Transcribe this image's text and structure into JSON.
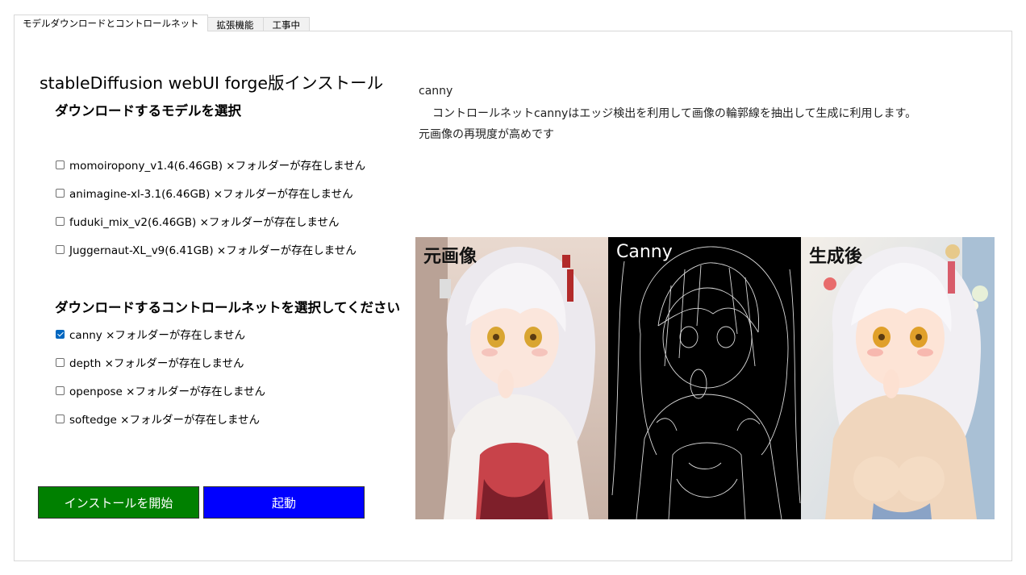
{
  "tabs": [
    {
      "label": "モデルダウンロードとコントロールネット",
      "active": true
    },
    {
      "label": "拡張機能",
      "active": false
    },
    {
      "label": "工事中",
      "active": false
    }
  ],
  "main": {
    "title": "stableDiffusion webUI forge版インストール",
    "model_section": "ダウンロードするモデルを選択",
    "models": [
      {
        "label": "momoiropony_v1.4(6.46GB) ×フォルダーが存在しません",
        "checked": false
      },
      {
        "label": "animagine-xl-3.1(6.46GB) ×フォルダーが存在しません",
        "checked": false
      },
      {
        "label": "fuduki_mix_v2(6.46GB) ×フォルダーが存在しません",
        "checked": false
      },
      {
        "label": "Juggernaut-XL_v9(6.41GB) ×フォルダーが存在しません",
        "checked": false
      }
    ],
    "controlnet_section": "ダウンロードするコントロールネットを選択してください",
    "controlnets": [
      {
        "label": "canny ×フォルダーが存在しません",
        "checked": true
      },
      {
        "label": "depth ×フォルダーが存在しません",
        "checked": false
      },
      {
        "label": "openpose ×フォルダーが存在しません",
        "checked": false
      },
      {
        "label": "softedge ×フォルダーが存在しません",
        "checked": false
      }
    ],
    "install_button": "インストールを開始",
    "launch_button": "起動"
  },
  "description": {
    "heading": "canny",
    "line1": "コントロールネットcannyはエッジ検出を利用して画像の輪郭線を抽出して生成に利用します。",
    "line2": "元画像の再現度が高めです"
  },
  "preview": {
    "original_label": "元画像",
    "canny_label": "Canny",
    "generated_label": "生成後"
  },
  "colors": {
    "install_button": "#008000",
    "launch_button": "#0000ff",
    "checkbox_checked": "#0067c0"
  }
}
